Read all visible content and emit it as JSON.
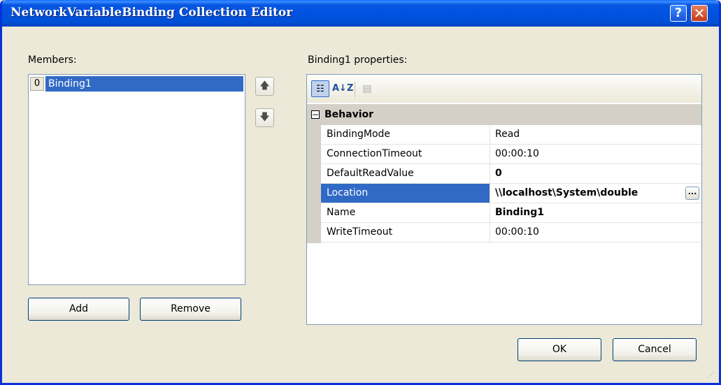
{
  "window": {
    "title": "NetworkVariableBinding Collection Editor",
    "help_label": "?",
    "close_label": "✕"
  },
  "members": {
    "label": "Members:",
    "items": [
      {
        "index": "0",
        "name": "Binding1"
      }
    ],
    "add_label": "Add",
    "remove_label": "Remove"
  },
  "properties": {
    "label": "Binding1 properties:",
    "toolbar": {
      "categorized_icon": "categorized-icon",
      "alphabetical_label": "A↓Z",
      "property_pages_icon": "property-pages-icon"
    },
    "category": {
      "expander": "−",
      "name": "Behavior"
    },
    "rows": [
      {
        "name": "BindingMode",
        "value": "Read"
      },
      {
        "name": "ConnectionTimeout",
        "value": "00:00:10"
      },
      {
        "name": "DefaultReadValue",
        "value": "0"
      },
      {
        "name": "Location",
        "value": "\\\\localhost\\System\\double"
      },
      {
        "name": "Name",
        "value": "Binding1"
      },
      {
        "name": "WriteTimeout",
        "value": "00:00:10"
      }
    ],
    "ellipsis_label": "..."
  },
  "buttons": {
    "ok": "OK",
    "cancel": "Cancel"
  },
  "colors": {
    "selection": "#316ac5",
    "title_bar": "#0052e0",
    "dialog_bg": "#ece9d8"
  }
}
